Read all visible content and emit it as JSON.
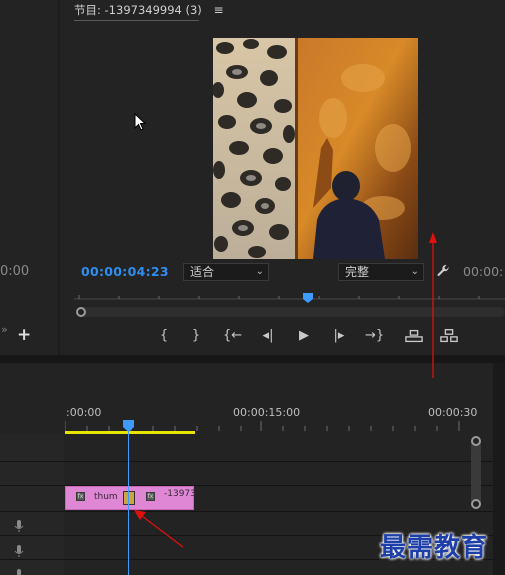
{
  "left_panel": {
    "timecode": "0:00"
  },
  "program_monitor": {
    "title": "节目: -1397349994 (3)",
    "menu_icon": "hamburger-menu-icon",
    "current_timecode": "00:00:04:23",
    "fit_label": "适合",
    "quality_label": "完整",
    "duration_timecode": "00:00:",
    "transport_buttons": [
      "add-marker",
      "mark-in",
      "mark-out",
      "go-to-in",
      "step-back",
      "play",
      "step-forward",
      "go-to-out",
      "lift",
      "extract"
    ],
    "playhead_fraction": 0.55
  },
  "timeline": {
    "ruler_labels": [
      ":00:00",
      "00:00:15:00",
      "00:00:30"
    ],
    "clip": {
      "label_1": "thum",
      "label_2": "-13973",
      "color": "#df86d5"
    },
    "playhead_color": "#3d9bff",
    "work_area_color": "#e5e500"
  },
  "watermark": "最需教育",
  "annotation_color": "#e01010"
}
